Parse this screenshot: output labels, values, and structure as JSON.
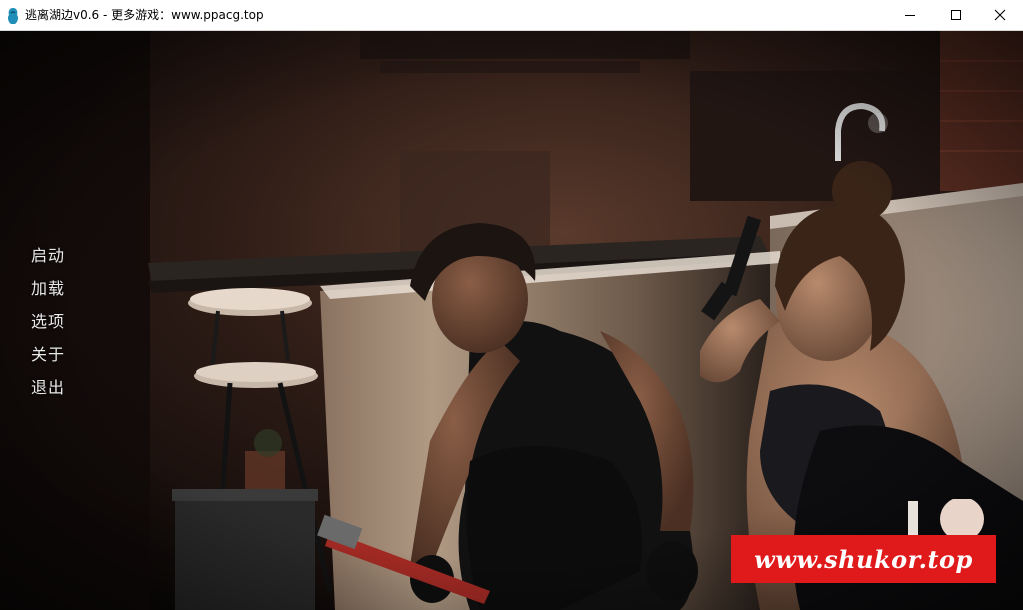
{
  "window": {
    "title": "逃离湖边v0.6 - 更多游戏：www.ppacg.top",
    "icon": "game-app-icon",
    "buttons": {
      "minimize_icon": "minimize-icon",
      "maximize_icon": "maximize-icon",
      "close_icon": "close-icon"
    }
  },
  "main_menu": {
    "items": [
      {
        "label": "启动"
      },
      {
        "label": "加载"
      },
      {
        "label": "选项"
      },
      {
        "label": "关于"
      },
      {
        "label": "退出"
      }
    ]
  },
  "watermark": {
    "text": "www.shukor.top",
    "color": "#e0191b"
  },
  "colors": {
    "menu_text": "#e9e9e9",
    "titlebar_bg": "#ffffff",
    "scene_dark": "#1b1110"
  }
}
